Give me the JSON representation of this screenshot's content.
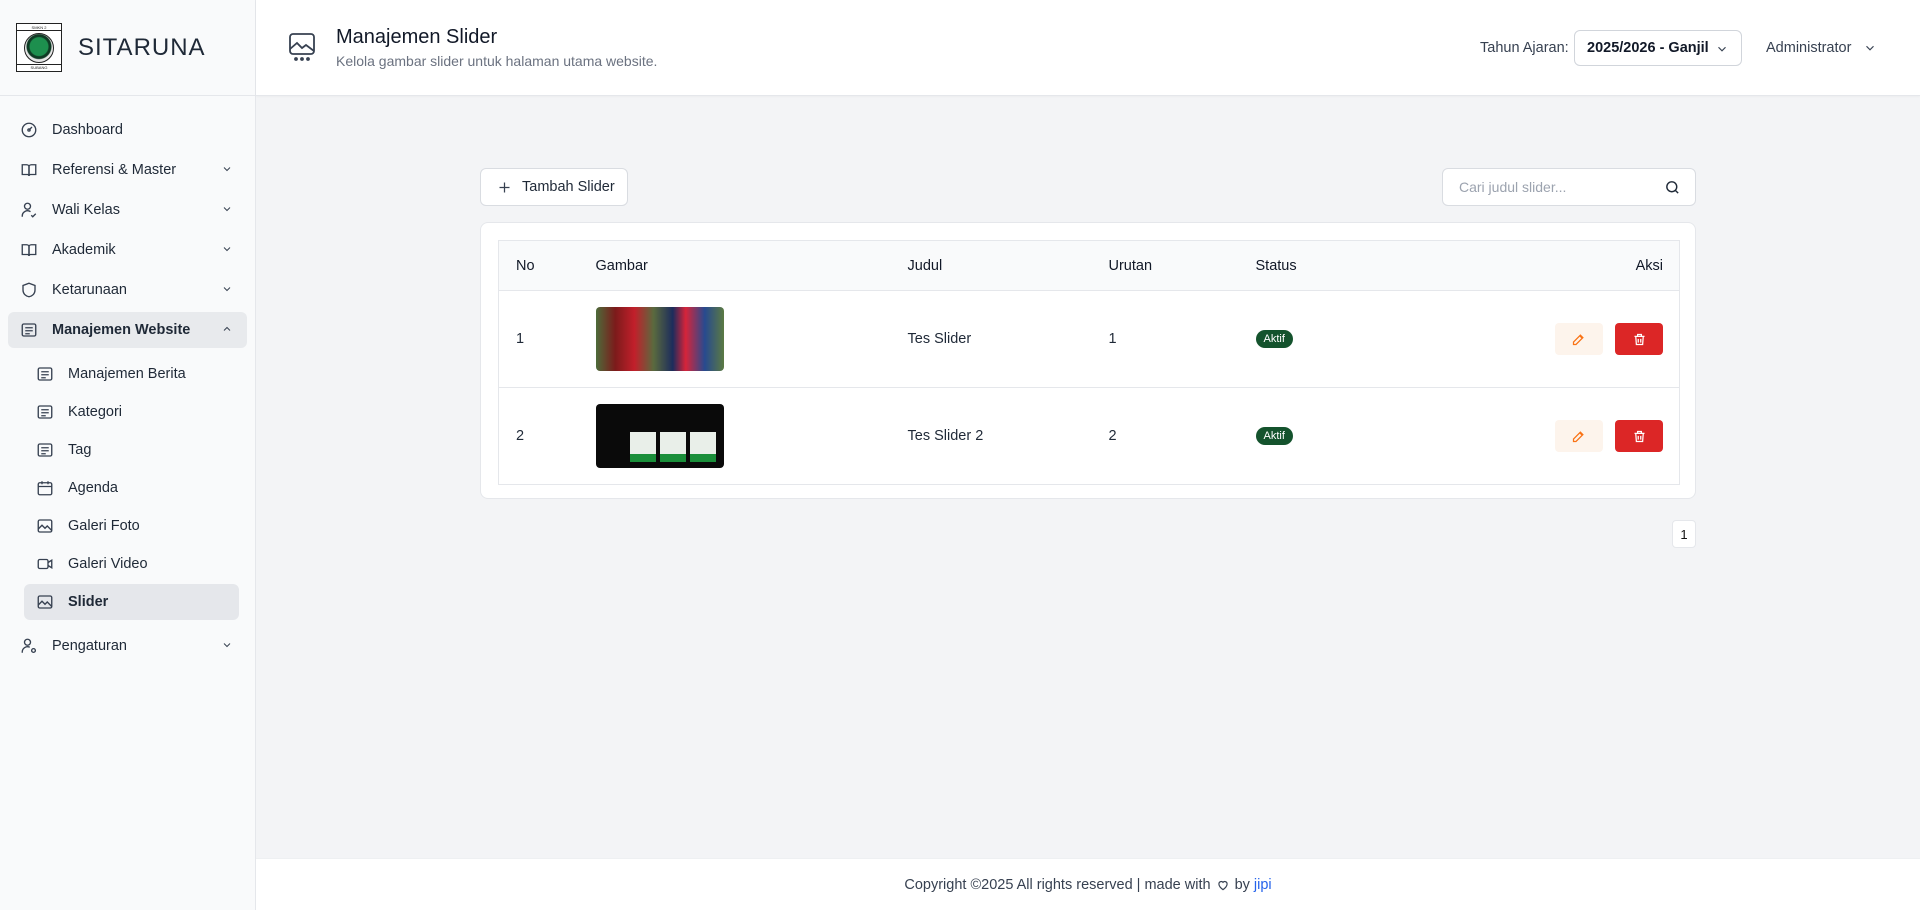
{
  "brand": {
    "name": "SITARUNA",
    "logo_top": "SMKN 2",
    "logo_bottom": "SUBANG"
  },
  "sidebar": {
    "items": [
      {
        "label": "Dashboard",
        "icon": "dashboard-icon"
      },
      {
        "label": "Referensi & Master",
        "icon": "book-icon",
        "expandable": true
      },
      {
        "label": "Wali Kelas",
        "icon": "user-check-icon",
        "expandable": true
      },
      {
        "label": "Akademik",
        "icon": "book-open-icon",
        "expandable": true
      },
      {
        "label": "Ketarunaan",
        "icon": "shield-icon",
        "expandable": true
      },
      {
        "label": "Manajemen Website",
        "icon": "document-icon",
        "expandable": true,
        "open": true
      }
    ],
    "sub_items": [
      {
        "label": "Manajemen Berita",
        "icon": "document-icon"
      },
      {
        "label": "Kategori",
        "icon": "document-icon"
      },
      {
        "label": "Tag",
        "icon": "document-icon"
      },
      {
        "label": "Agenda",
        "icon": "calendar-icon"
      },
      {
        "label": "Galeri Foto",
        "icon": "image-icon"
      },
      {
        "label": "Galeri Video",
        "icon": "video-icon"
      },
      {
        "label": "Slider",
        "icon": "image-icon",
        "active": true
      }
    ],
    "settings": {
      "label": "Pengaturan",
      "icon": "user-gear-icon"
    }
  },
  "header": {
    "title": "Manajemen Slider",
    "subtitle": "Kelola gambar slider untuk halaman utama website.",
    "year_label": "Tahun Ajaran:",
    "year_value": "2025/2026 - Ganjil",
    "user": "Administrator"
  },
  "toolbar": {
    "add_label": "Tambah Slider",
    "search_placeholder": "Cari judul slider..."
  },
  "table": {
    "columns": [
      "No",
      "Gambar",
      "Judul",
      "Urutan",
      "Status",
      "Aksi"
    ],
    "rows": [
      {
        "no": "1",
        "judul": "Tes Slider",
        "urutan": "1",
        "status": "Aktif"
      },
      {
        "no": "2",
        "judul": "Tes Slider 2",
        "urutan": "2",
        "status": "Aktif"
      }
    ]
  },
  "pagination": {
    "current": "1"
  },
  "footer": {
    "text": "Copyright ©2025 All rights reserved | made with",
    "by": "by",
    "author": "jipi"
  },
  "colors": {
    "active_badge": "#14532d",
    "delete": "#dc2626",
    "edit_bg": "#fdf4ec",
    "link": "#2563eb"
  }
}
